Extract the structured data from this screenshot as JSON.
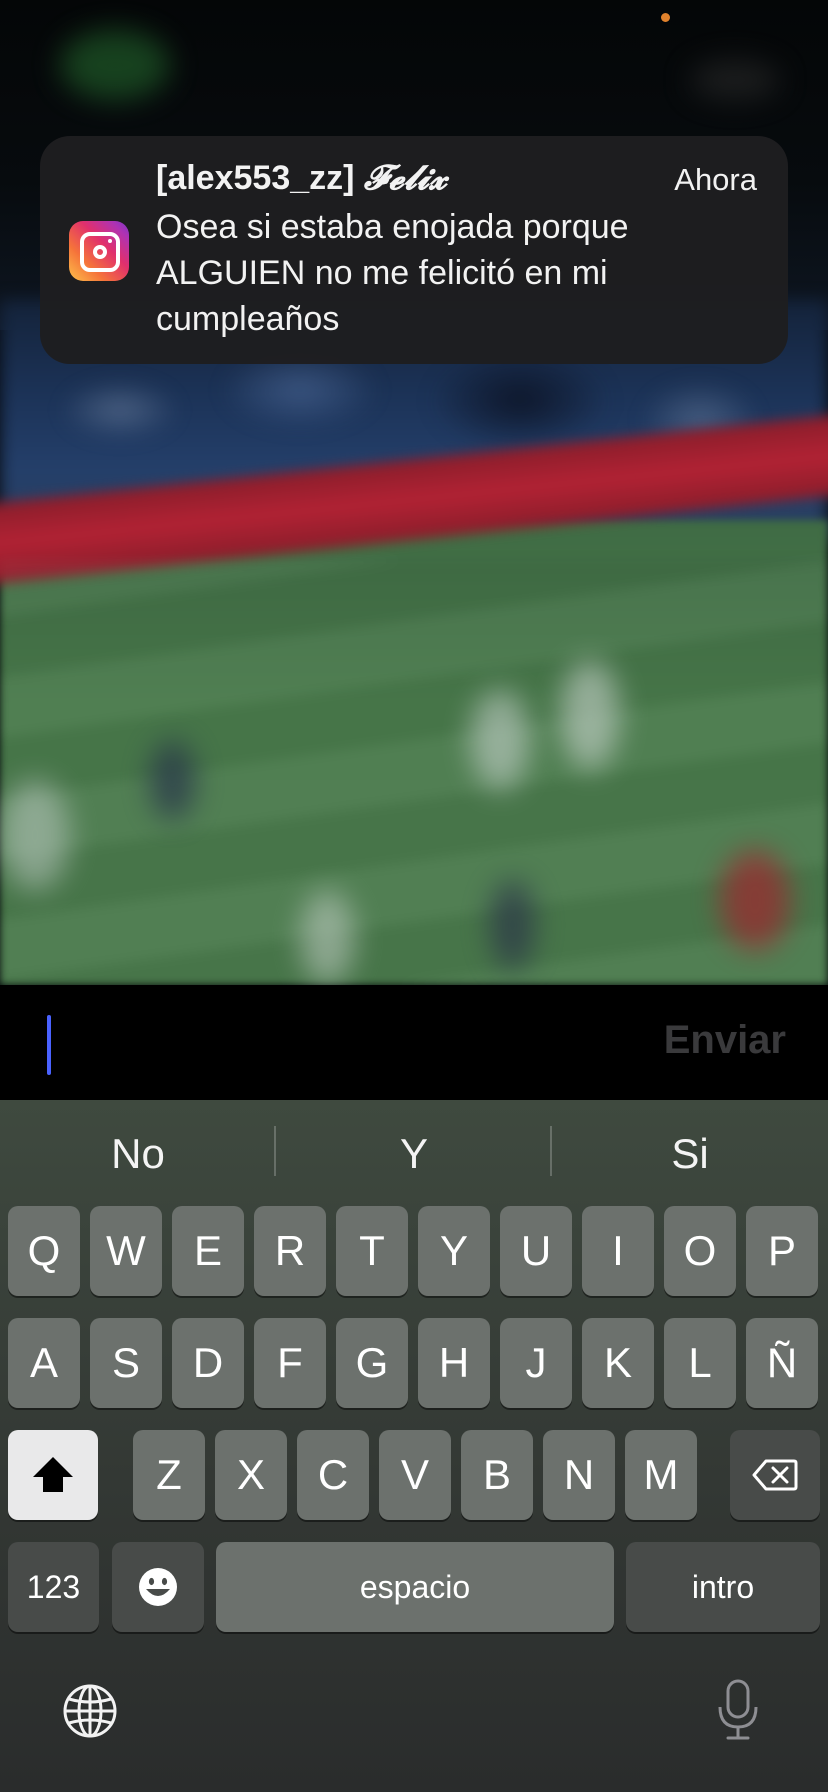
{
  "notification": {
    "app_icon": "instagram-icon",
    "sender": "[alex553_zz]",
    "sender_name": "𝓕𝓮𝓵𝓲𝔁",
    "time": "Ahora",
    "message": "Osea si estaba enojada porque ALGUIEN no me felicitó en mi cumpleaños"
  },
  "reply": {
    "input_value": "",
    "send_label": "Enviar"
  },
  "keyboard": {
    "suggestions": [
      "No",
      "Y",
      "Si"
    ],
    "row1": [
      "Q",
      "W",
      "E",
      "R",
      "T",
      "Y",
      "U",
      "I",
      "O",
      "P"
    ],
    "row2": [
      "A",
      "S",
      "D",
      "F",
      "G",
      "H",
      "J",
      "K",
      "L",
      "Ñ"
    ],
    "row3": [
      "Z",
      "X",
      "C",
      "V",
      "B",
      "N",
      "M"
    ],
    "numbers_label": "123",
    "space_label": "espacio",
    "return_label": "intro",
    "shift_icon": "shift-arrow-icon",
    "delete_icon": "delete-backspace-icon",
    "emoji_icon": "emoji-icon",
    "globe_icon": "globe-icon",
    "mic_icon": "microphone-icon"
  },
  "colors": {
    "accent_cursor": "#4a62ff",
    "notification_bg": "#1e1e20",
    "status_dot": "#e0812c"
  }
}
